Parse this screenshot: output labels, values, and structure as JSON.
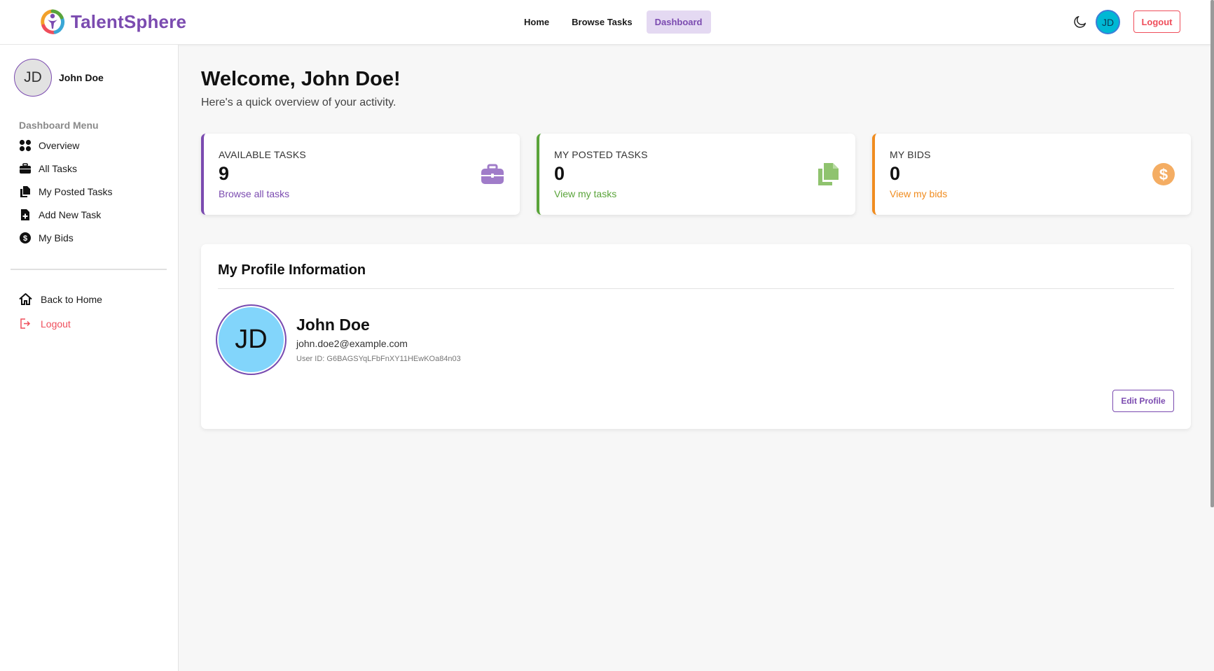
{
  "brand": {
    "name": "TalentSphere",
    "color": "#7b4bb0"
  },
  "nav": {
    "links": [
      {
        "label": "Home"
      },
      {
        "label": "Browse Tasks"
      },
      {
        "label": "Dashboard",
        "active": true
      }
    ],
    "theme_toggle_icon": "moon-icon",
    "avatar_initials": "JD",
    "logout_label": "Logout"
  },
  "sidebar": {
    "user": {
      "initials": "JD",
      "name": "John Doe"
    },
    "menu_heading": "Dashboard Menu",
    "items": [
      {
        "label": "Overview",
        "icon": "grid-icon"
      },
      {
        "label": "All Tasks",
        "icon": "briefcase-icon"
      },
      {
        "label": "My Posted Tasks",
        "icon": "files-icon"
      },
      {
        "label": "Add New Task",
        "icon": "file-plus-icon"
      },
      {
        "label": "My Bids",
        "icon": "dollar-circle-icon"
      }
    ],
    "footer_items": [
      {
        "label": "Back to Home",
        "icon": "home-icon"
      },
      {
        "label": "Logout",
        "icon": "sign-out-icon"
      }
    ]
  },
  "main": {
    "title": "Welcome, John Doe!",
    "subtitle": "Here's a quick overview of your activity.",
    "stats": [
      {
        "label": "AVAILABLE TASKS",
        "value": "9",
        "link": "Browse all tasks",
        "color": "#7b4bb0",
        "icon": "briefcase-icon"
      },
      {
        "label": "MY POSTED TASKS",
        "value": "0",
        "link": "View my tasks",
        "color": "#5aa43a",
        "icon": "files-icon"
      },
      {
        "label": "MY BIDS",
        "value": "0",
        "link": "View my bids",
        "color": "#f08c1f",
        "icon": "dollar-circle-icon"
      }
    ]
  },
  "profile": {
    "heading": "My Profile Information",
    "initials": "JD",
    "name": "John Doe",
    "email": "john.doe2@example.com",
    "user_id": "User ID: G6BAGSYqLFbFnXY11HEwKOa84n03",
    "edit_label": "Edit Profile"
  }
}
